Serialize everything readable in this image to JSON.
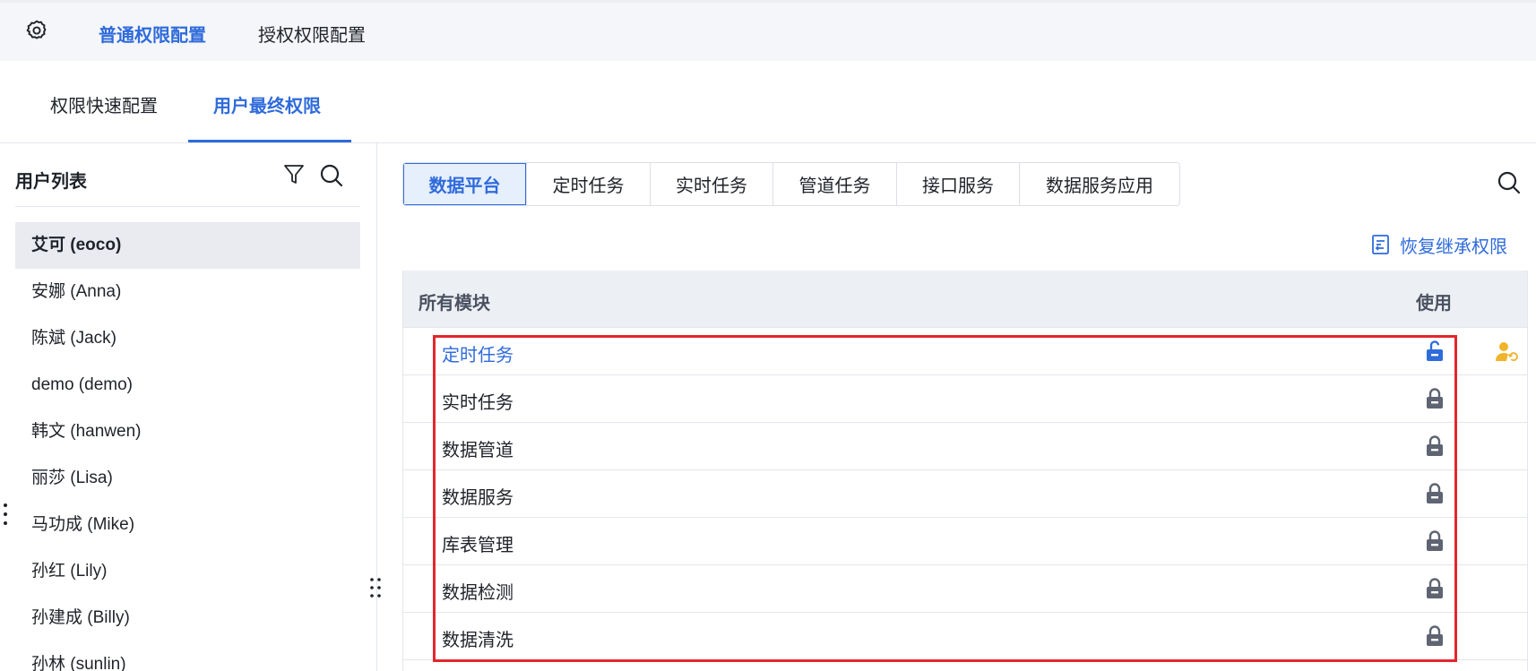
{
  "topbar": {
    "tabs": [
      {
        "label": "普通权限配置",
        "active": true
      },
      {
        "label": "授权权限配置",
        "active": false
      }
    ]
  },
  "subtabs": [
    {
      "label": "权限快速配置",
      "active": false
    },
    {
      "label": "用户最终权限",
      "active": true
    }
  ],
  "user_panel": {
    "title": "用户列表",
    "users": [
      "艾可 (eoco)",
      "安娜 (Anna)",
      "陈斌 (Jack)",
      "demo (demo)",
      "韩文 (hanwen)",
      "丽莎 (Lisa)",
      "马功成 (Mike)",
      "孙红 (Lily)",
      "孙建成 (Billy)",
      "孙林 (sunlin)"
    ],
    "selected_user": "艾可 (eoco)"
  },
  "module_tabs": [
    {
      "label": "数据平台",
      "active": true
    },
    {
      "label": "定时任务",
      "active": false
    },
    {
      "label": "实时任务",
      "active": false
    },
    {
      "label": "管道任务",
      "active": false
    },
    {
      "label": "接口服务",
      "active": false
    },
    {
      "label": "数据服务应用",
      "active": false
    }
  ],
  "restore_label": "恢复继承权限",
  "table": {
    "headers": {
      "module": "所有模块",
      "use": "使用"
    },
    "rows": [
      {
        "name": "定时任务",
        "lock": "unlocked",
        "link": true
      },
      {
        "name": "实时任务",
        "lock": "locked"
      },
      {
        "name": "数据管道",
        "lock": "locked"
      },
      {
        "name": "数据服务",
        "lock": "locked"
      },
      {
        "name": "库表管理",
        "lock": "locked"
      },
      {
        "name": "数据检测",
        "lock": "locked"
      },
      {
        "name": "数据清洗",
        "lock": "locked"
      }
    ]
  },
  "colors": {
    "accent": "#2f6bdb",
    "highlight": "#e3262c",
    "lock": "#5f6472",
    "user_icon": "#f0b429"
  },
  "icons": {
    "settings": "gear-icon",
    "filter": "filter-icon",
    "search": "search-icon",
    "restore": "restore-document-icon",
    "lock": "lock-icon",
    "unlock": "unlock-icon",
    "user_reset": "user-reset-icon"
  }
}
